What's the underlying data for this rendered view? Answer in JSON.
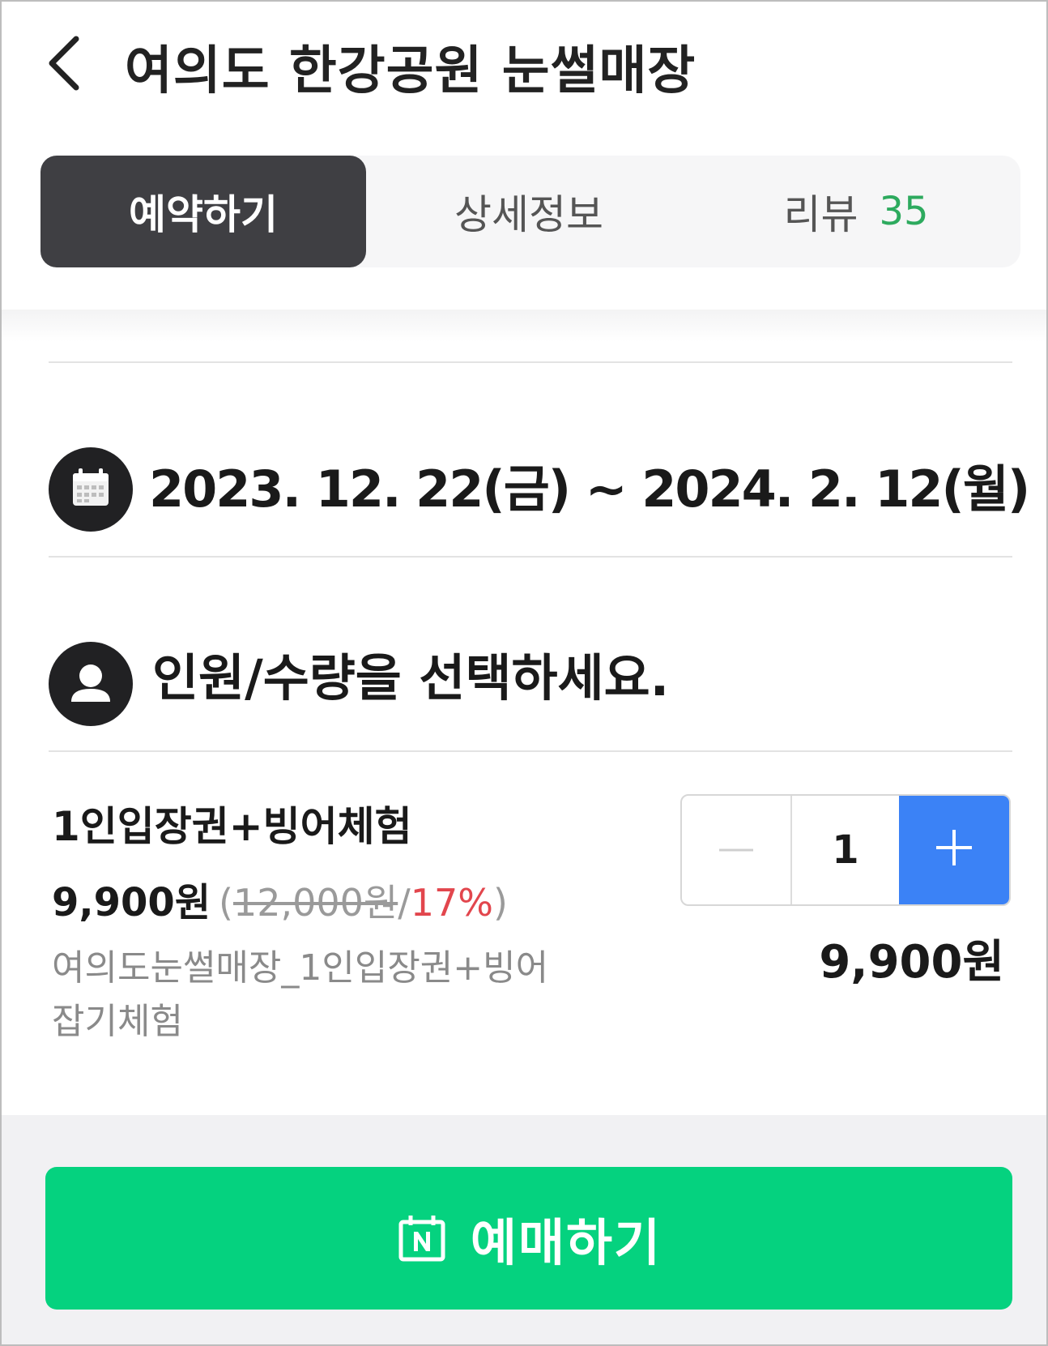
{
  "header": {
    "title": "여의도 한강공원 눈썰매장",
    "back_icon": "chevron-left-icon"
  },
  "tabs": [
    {
      "label": "예약하기",
      "active": true
    },
    {
      "label": "상세정보",
      "active": false
    },
    {
      "label": "리뷰",
      "count": "35",
      "active": false
    }
  ],
  "schedule": {
    "icon": "calendar-icon",
    "date_range": "2023. 12. 22(금) ~ 2024. 2. 12(월)"
  },
  "quantity_section": {
    "icon": "person-icon",
    "prompt": "인원/수량을 선택하세요."
  },
  "product": {
    "name": "1인입장권+빙어체험",
    "price": "9,900원",
    "paren_open": "(",
    "original_price": "12,000원",
    "slash": "/",
    "discount": "17%",
    "paren_close": ")",
    "description": "여의도눈썰매장_1인입장권+빙어잡기체험",
    "quantity": "1",
    "subtotal": "9,900원"
  },
  "footer": {
    "buy_label": "예매하기",
    "buy_icon": "naver-calendar-icon"
  },
  "colors": {
    "tab_active": "#3f3f43",
    "review_count": "#2daa5e",
    "discount": "#e2464d",
    "stepper_plus": "#3b82f6",
    "buy_button": "#05d27f"
  }
}
